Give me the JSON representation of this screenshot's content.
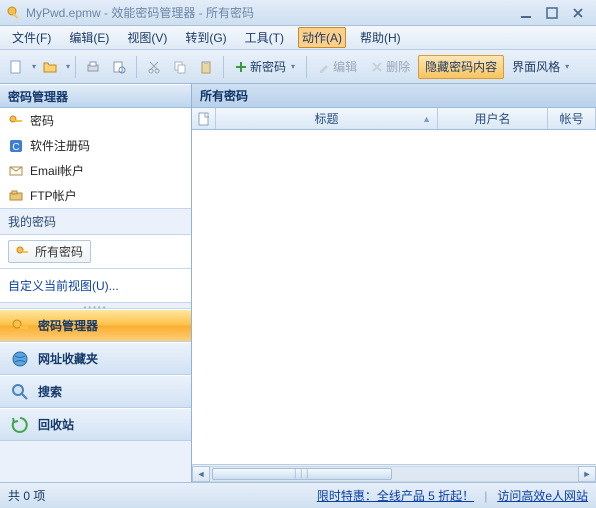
{
  "title": "MyPwd.epmw - 效能密码管理器 - 所有密码",
  "menu": {
    "file": "文件(F)",
    "edit": "编辑(E)",
    "view": "视图(V)",
    "goto": "转到(G)",
    "tools": "工具(T)",
    "action": "动作(A)",
    "help": "帮助(H)"
  },
  "toolbar": {
    "new_password": "新密码",
    "edit_btn": "编辑",
    "delete_btn": "删除",
    "hide_content": "隐藏密码内容",
    "ui_style": "界面风格"
  },
  "sidebar": {
    "title": "密码管理器",
    "tree": {
      "password": "密码",
      "software_reg": "软件注册码",
      "email_acct": "Email帐户",
      "ftp_acct": "FTP帐户"
    },
    "my_pwd_label": "我的密码",
    "all_pwd_chip": "所有密码",
    "custom_view": "自定义当前视图(U)...",
    "nav": {
      "pwd_mgr": "密码管理器",
      "bookmarks": "网址收藏夹",
      "search": "搜索",
      "recycle": "回收站"
    }
  },
  "content": {
    "header": "所有密码",
    "columns": {
      "title": "标题",
      "user": "用户名",
      "acct": "帐号"
    }
  },
  "status": {
    "count": "共 0 项",
    "promo": "限时特惠：全线产品 5 折起！",
    "site": "访问高效e人网站"
  }
}
